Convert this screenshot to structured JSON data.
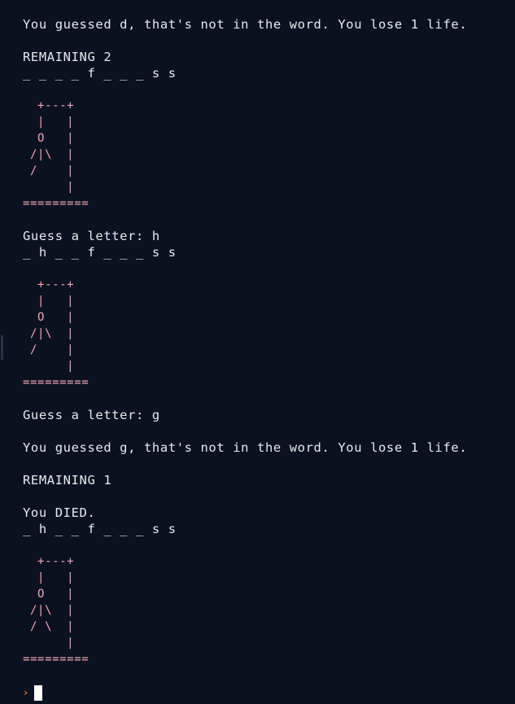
{
  "terminal": {
    "lines": [
      {
        "text": "You guessed d, that's not in the word. You lose 1 life.",
        "kind": "text"
      },
      {
        "text": "",
        "kind": "text"
      },
      {
        "text": "REMAINING 2",
        "kind": "text"
      },
      {
        "text": "_ _ _ _ f _ _ _ s s",
        "kind": "text"
      },
      {
        "text": "",
        "kind": "text"
      },
      {
        "text": "  +---+",
        "kind": "art"
      },
      {
        "text": "  |   |",
        "kind": "art"
      },
      {
        "text": "  O   |",
        "kind": "art"
      },
      {
        "text": " /|\\  |",
        "kind": "art"
      },
      {
        "text": " /    |",
        "kind": "art"
      },
      {
        "text": "      |",
        "kind": "art"
      },
      {
        "text": "=========",
        "kind": "art"
      },
      {
        "text": "",
        "kind": "text"
      },
      {
        "text": "Guess a letter: h",
        "kind": "text"
      },
      {
        "text": "_ h _ _ f _ _ _ s s",
        "kind": "text"
      },
      {
        "text": "",
        "kind": "text"
      },
      {
        "text": "  +---+",
        "kind": "art"
      },
      {
        "text": "  |   |",
        "kind": "art"
      },
      {
        "text": "  O   |",
        "kind": "art"
      },
      {
        "text": " /|\\  |",
        "kind": "art"
      },
      {
        "text": " /    |",
        "kind": "art"
      },
      {
        "text": "      |",
        "kind": "art"
      },
      {
        "text": "=========",
        "kind": "art"
      },
      {
        "text": "",
        "kind": "text"
      },
      {
        "text": "Guess a letter: g",
        "kind": "text"
      },
      {
        "text": "",
        "kind": "text"
      },
      {
        "text": "You guessed g, that's not in the word. You lose 1 life.",
        "kind": "text"
      },
      {
        "text": "",
        "kind": "text"
      },
      {
        "text": "REMAINING 1",
        "kind": "text"
      },
      {
        "text": "",
        "kind": "text"
      },
      {
        "text": "You DIED.",
        "kind": "text"
      },
      {
        "text": "_ h _ _ f _ _ _ s s",
        "kind": "text"
      },
      {
        "text": "",
        "kind": "text"
      },
      {
        "text": "  +---+",
        "kind": "art"
      },
      {
        "text": "  |   |",
        "kind": "art"
      },
      {
        "text": "  O   |",
        "kind": "art"
      },
      {
        "text": " /|\\  |",
        "kind": "art"
      },
      {
        "text": " / \\  |",
        "kind": "art"
      },
      {
        "text": "      |",
        "kind": "art"
      },
      {
        "text": "=========",
        "kind": "art"
      }
    ],
    "prompt_symbol": "›",
    "colors": {
      "background": "#0c1120",
      "text": "#e8e9ee",
      "art": "#f0a8b8",
      "prompt": "#e8763a",
      "cursor": "#ffffff"
    }
  }
}
